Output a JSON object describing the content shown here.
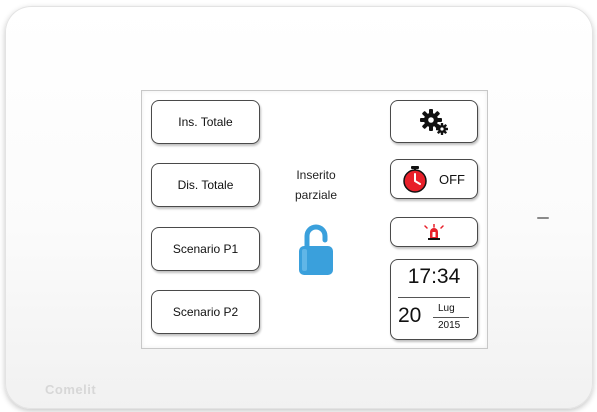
{
  "brand": {
    "name": "Comelit"
  },
  "left_buttons": [
    {
      "label": "Ins. Totale"
    },
    {
      "label": "Dis. Totale"
    },
    {
      "label": "Scenario P1"
    },
    {
      "label": "Scenario P2"
    }
  ],
  "status": {
    "line1": "Inserito",
    "line2": "parziale",
    "icon": "open-padlock-icon",
    "icon_color": "#3aa0dc"
  },
  "right_panel": {
    "settings_icon": "gears-icon",
    "timer": {
      "icon": "stopwatch-icon",
      "icon_color": "#e8202a",
      "label": "OFF"
    },
    "alarm_icon": "alarm-siren-icon",
    "alarm_icon_color": "#e8202a"
  },
  "clock": {
    "time": "17:34",
    "day": "20",
    "month": "Lug",
    "year": "2015"
  }
}
